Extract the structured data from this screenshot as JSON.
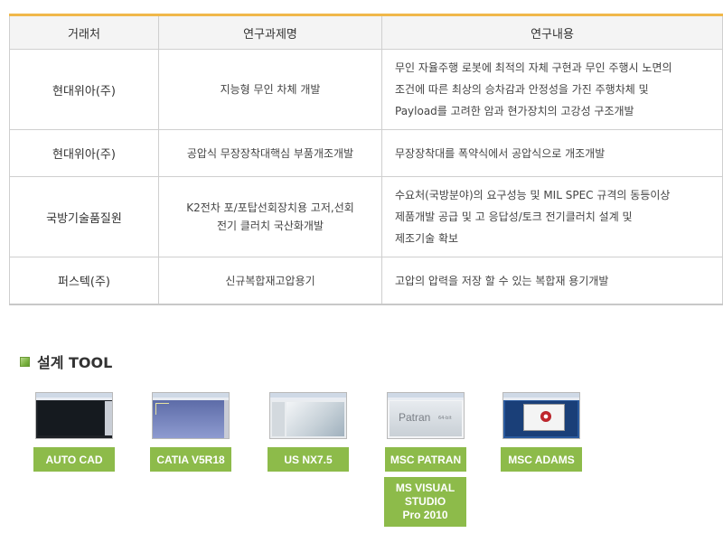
{
  "table": {
    "headers": [
      "거래처",
      "연구과제명",
      "연구내용"
    ],
    "rows": [
      {
        "client": "현대위아(주)",
        "project": [
          "지능형 무인 차체 개발"
        ],
        "content": [
          "무인 자율주행 로봇에 최적의 자체 구현과 무인 주행시 노면의",
          "조건에 따른 최상의 승차감과 안정성을 가진 주행차체 및",
          "Payload를 고려한 암과 현가장치의 고강성 구조개발"
        ]
      },
      {
        "client": "현대위아(주)",
        "project": [
          "공압식 무장장착대핵심 부품개조개발"
        ],
        "content": [
          "무장장착대를 폭약식에서 공압식으로 개조개발"
        ]
      },
      {
        "client": "국방기술품질원",
        "project": [
          "K2전차 포/포탑선회장치용 고저,선회",
          "전기 클러치 국산화개발"
        ],
        "content": [
          "수요처(국방분야)의 요구성능 및 MIL SPEC 규격의 동등이상",
          "제품개발 공급 및 고 응답성/토크 전기클러치 설계 및",
          "제조기술 확보"
        ]
      },
      {
        "client": "퍼스텍(주)",
        "project": [
          "신규복합재고압용기"
        ],
        "content": [
          "고압의 압력을 저장 할 수 있는 복합재 용기개발"
        ]
      }
    ]
  },
  "design_tools": {
    "title": "설계 TOOL",
    "accent_color": "#8dbb4a",
    "tools": [
      {
        "label": "AUTO CAD",
        "icon": "autocad-screenshot"
      },
      {
        "label": "CATIA V5R18",
        "icon": "catia-screenshot"
      },
      {
        "label": "US NX7.5",
        "icon": "nx-screenshot"
      },
      {
        "label": "MSC PATRAN",
        "icon": "patran-screenshot",
        "thumb_text": "Patran",
        "thumb_version": "64-bit"
      },
      {
        "label": "MSC ADAMS",
        "icon": "adams-screenshot"
      }
    ],
    "extra_tool": {
      "lines": [
        "MS VISUAL",
        "STUDIO",
        "Pro 2010"
      ]
    }
  }
}
